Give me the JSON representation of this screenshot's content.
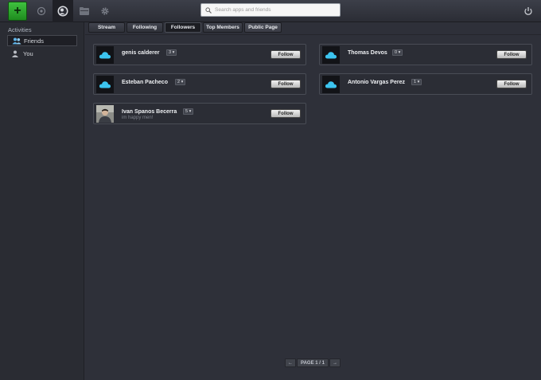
{
  "toolbar": {
    "add_label": "+",
    "search_placeholder": "Search apps and friends",
    "icons": [
      "plus-icon",
      "home-icon",
      "social-icon",
      "folder-icon",
      "gear-icon",
      "power-icon"
    ]
  },
  "sidebar": {
    "heading": "Activities",
    "items": [
      {
        "label": "Friends",
        "icon": "people-icon",
        "active": true
      },
      {
        "label": "You",
        "icon": "person-icon",
        "active": false
      }
    ]
  },
  "tabs": [
    {
      "label": "Stream"
    },
    {
      "label": "Following"
    },
    {
      "label": "Followers",
      "active": true
    },
    {
      "label": "Top Members"
    },
    {
      "label": "Public Page"
    }
  ],
  "followers": [
    {
      "name": "genis calderer",
      "count": "3",
      "follow_label": "Follow",
      "avatar": "cloud-icon",
      "status": ""
    },
    {
      "name": "Thomas Devos",
      "count": "0",
      "follow_label": "Follow",
      "avatar": "cloud-icon",
      "status": ""
    },
    {
      "name": "Esteban Pacheco",
      "count": "2",
      "follow_label": "Follow",
      "avatar": "cloud-icon",
      "status": ""
    },
    {
      "name": "Antonio Vargas Perez",
      "count": "1",
      "follow_label": "Follow",
      "avatar": "cloud-icon",
      "status": ""
    },
    {
      "name": "Ivan Spanos Becerra",
      "count": "5",
      "follow_label": "Follow",
      "avatar": "photo",
      "status": "im happy men!"
    }
  ],
  "pager": {
    "prev": "←",
    "label": "PAGE 1 / 1",
    "next": "→"
  },
  "colors": {
    "background": "#2e3039",
    "add_button": "#2aa52a",
    "cloud": "#3cc4ef"
  }
}
